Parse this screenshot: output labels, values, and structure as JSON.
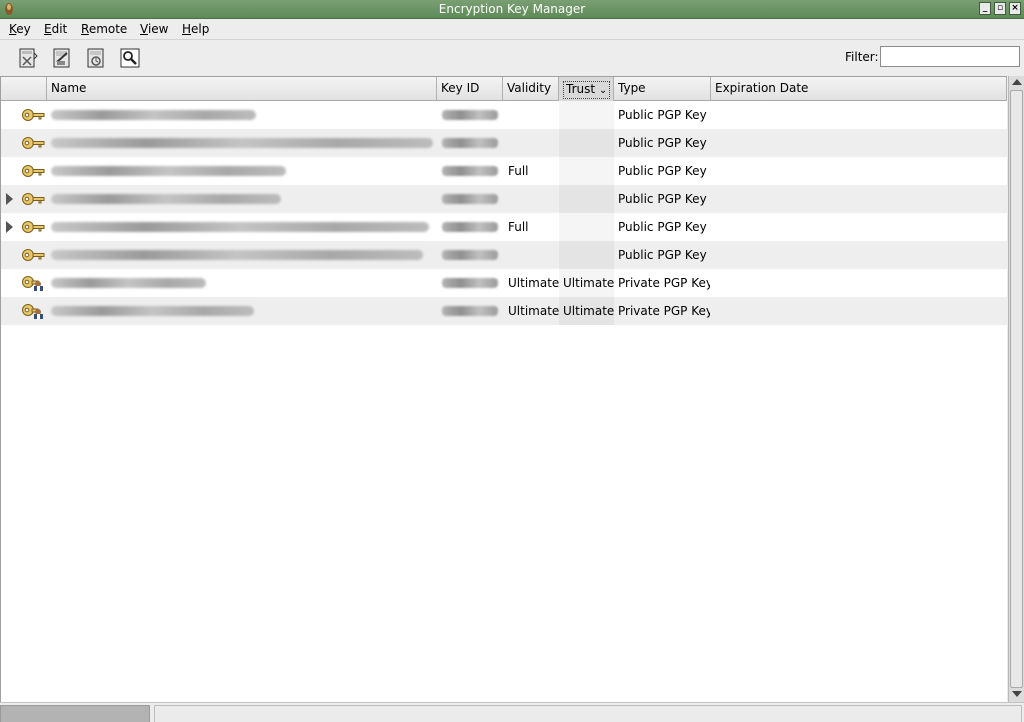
{
  "window": {
    "title": "Encryption Key Manager"
  },
  "menu": [
    {
      "mnemonic": "K",
      "rest": "ey"
    },
    {
      "mnemonic": "E",
      "rest": "dit"
    },
    {
      "mnemonic": "R",
      "rest": "emote"
    },
    {
      "mnemonic": "V",
      "rest": "iew"
    },
    {
      "mnemonic": "H",
      "rest": "elp"
    }
  ],
  "toolbar": {
    "buttons": [
      "export-icon",
      "sign-icon",
      "properties-icon",
      "find-remote-icon"
    ],
    "filter_label": "Filter:",
    "filter_value": ""
  },
  "columns": {
    "name": "Name",
    "key_id": "Key ID",
    "validity": "Validity",
    "trust": "Trust",
    "type": "Type",
    "expiration": "Expiration Date"
  },
  "rows": [
    {
      "validity": "",
      "trust": "",
      "type": "Public PGP Key",
      "expandable": false,
      "icon": "public-key-icon"
    },
    {
      "validity": "",
      "trust": "",
      "type": "Public PGP Key",
      "expandable": false,
      "icon": "public-key-icon"
    },
    {
      "validity": "Full",
      "trust": "",
      "type": "Public PGP Key",
      "expandable": false,
      "icon": "public-key-icon"
    },
    {
      "validity": "",
      "trust": "",
      "type": "Public PGP Key",
      "expandable": true,
      "icon": "public-key-icon"
    },
    {
      "validity": "Full",
      "trust": "",
      "type": "Public PGP Key",
      "expandable": true,
      "icon": "public-key-icon"
    },
    {
      "validity": "",
      "trust": "",
      "type": "Public PGP Key",
      "expandable": false,
      "icon": "public-key-icon"
    },
    {
      "validity": "Ultimate",
      "trust": "Ultimate",
      "type": "Private PGP Key",
      "expandable": false,
      "icon": "private-key-icon"
    },
    {
      "validity": "Ultimate",
      "trust": "Ultimate",
      "type": "Private PGP Key",
      "expandable": false,
      "icon": "private-key-icon"
    }
  ]
}
